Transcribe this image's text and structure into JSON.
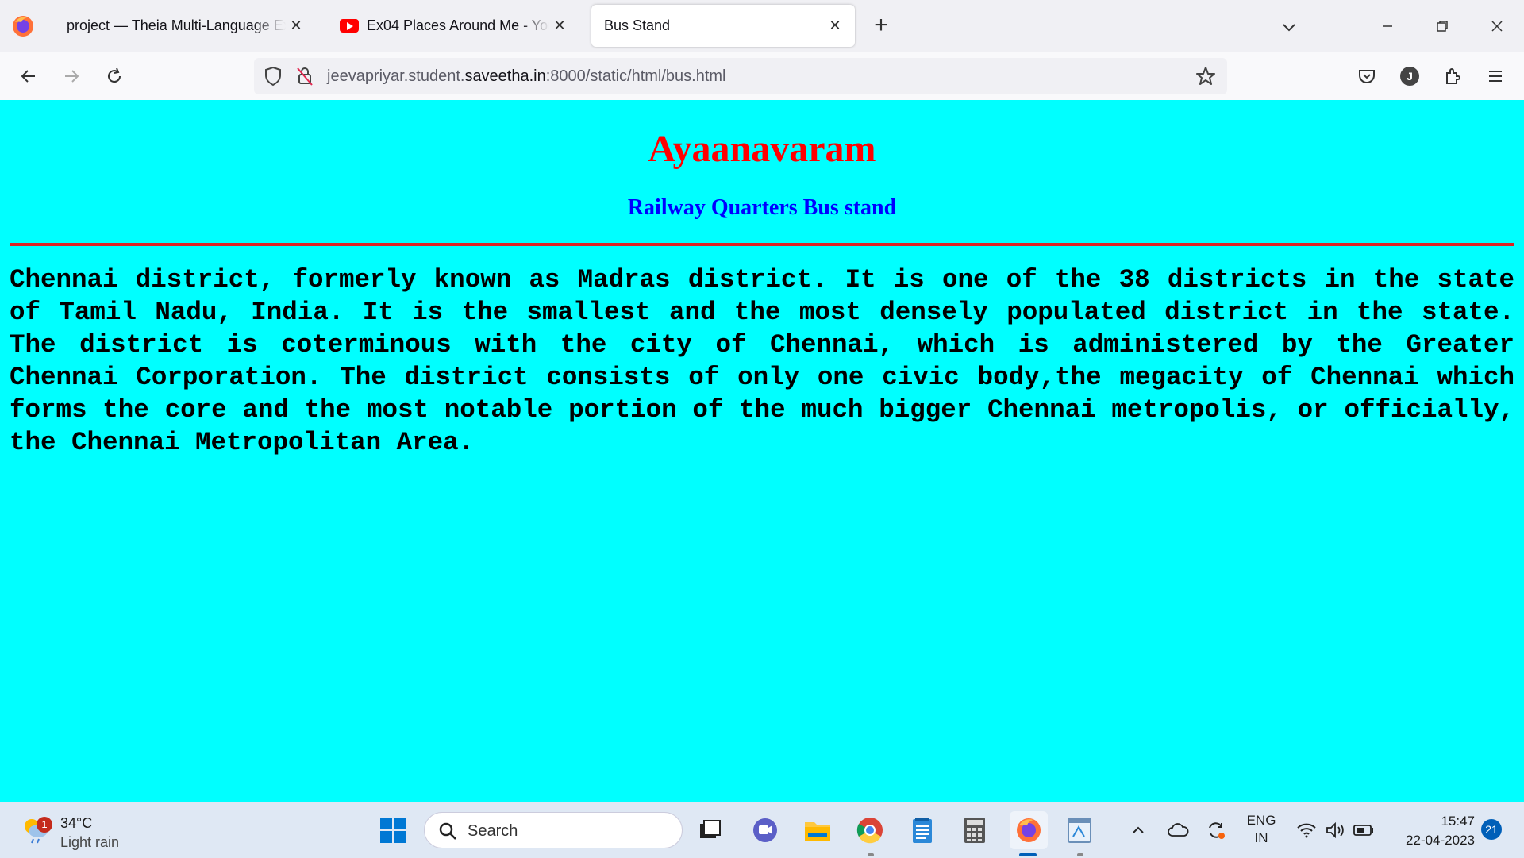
{
  "browser": {
    "tabs": [
      {
        "title": "project — Theia Multi-Language Explorer",
        "active": false
      },
      {
        "title": "Ex04 Places Around Me - YouTube",
        "active": false
      },
      {
        "title": "Bus Stand",
        "active": true
      }
    ],
    "close_glyph": "✕",
    "newtab_glyph": "+",
    "url": {
      "prefix": "jeevapriyar.student.",
      "domain": "saveetha.in",
      "suffix": ":8000/static/html/bus.html"
    },
    "account_initial": "J"
  },
  "page": {
    "background": "#00ffff",
    "title": "Ayaanavaram",
    "title_color": "#ff0000",
    "subtitle": "Railway Quarters Bus stand",
    "subtitle_color": "#0000ff",
    "rule_color": "#e02020",
    "body": "Chennai district, formerly known as Madras district. It is one of the 38 districts in the state of Tamil Nadu, India. It is the smallest and the most densely populated district in the state. The district is coterminous with the city of Chennai, which is administered by the Greater Chennai Corporation. The district consists of only one civic body,the megacity of Chennai which forms the core and the most notable portion of the much bigger Chennai metropolis, or officially, the Chennai Metropolitan Area."
  },
  "taskbar": {
    "weather": {
      "temp": "34°C",
      "condition": "Light rain",
      "badge": "1"
    },
    "search_label": "Search",
    "language": {
      "line1": "ENG",
      "line2": "IN"
    },
    "clock": {
      "time": "15:47",
      "date": "22-04-2023"
    },
    "notification_count": "21"
  }
}
